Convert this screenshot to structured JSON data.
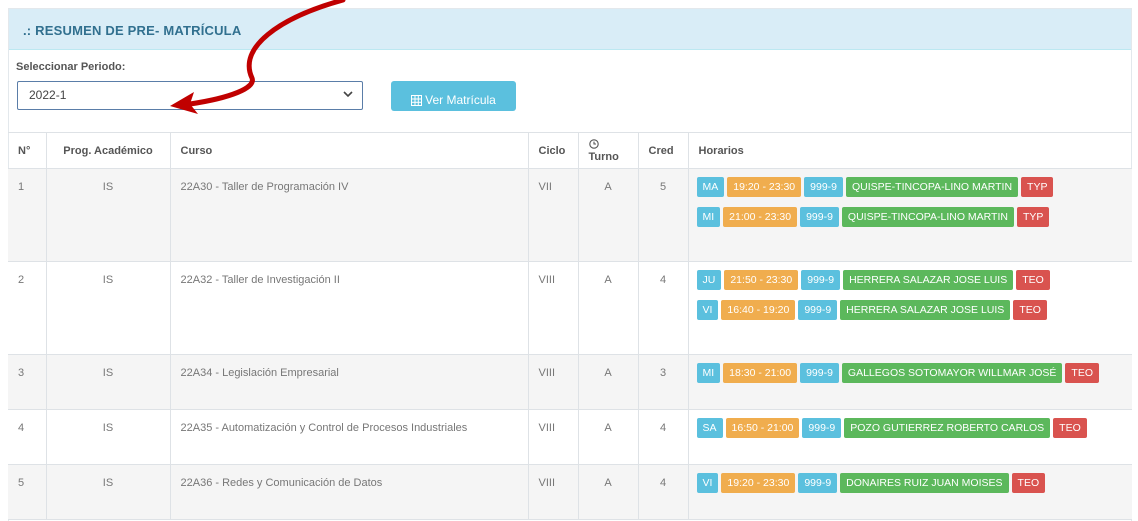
{
  "panel": {
    "title": ".: RESUMEN DE PRE- MATRÍCULA"
  },
  "filter": {
    "label": "Seleccionar Periodo:",
    "selected": "2022-1",
    "button_label": "Ver Matrícula"
  },
  "table": {
    "headers": {
      "num": "N°",
      "prog": "Prog. Académico",
      "curso": "Curso",
      "ciclo": "Ciclo",
      "turno": "Turno",
      "cred": "Cred",
      "horarios": "Horarios"
    },
    "rows": [
      {
        "num": "1",
        "prog": "IS",
        "curso": "22A30 - Taller de Programación IV",
        "ciclo": "VII",
        "turno": "A",
        "cred": "5",
        "horarios": [
          {
            "day": "MA",
            "time": "19:20 - 23:30",
            "room": "999-9",
            "teacher": "QUISPE-TINCOPA-LINO MARTIN",
            "type": "TYP"
          },
          {
            "day": "MI",
            "time": "21:00 - 23:30",
            "room": "999-9",
            "teacher": "QUISPE-TINCOPA-LINO MARTIN",
            "type": "TYP"
          }
        ]
      },
      {
        "num": "2",
        "prog": "IS",
        "curso": "22A32 - Taller de Investigación II",
        "ciclo": "VIII",
        "turno": "A",
        "cred": "4",
        "horarios": [
          {
            "day": "JU",
            "time": "21:50 - 23:30",
            "room": "999-9",
            "teacher": "HERRERA SALAZAR JOSE LUIS",
            "type": "TEO"
          },
          {
            "day": "VI",
            "time": "16:40 - 19:20",
            "room": "999-9",
            "teacher": "HERRERA SALAZAR JOSE LUIS",
            "type": "TEO"
          }
        ]
      },
      {
        "num": "3",
        "prog": "IS",
        "curso": "22A34 - Legislación Empresarial",
        "ciclo": "VIII",
        "turno": "A",
        "cred": "3",
        "horarios": [
          {
            "day": "MI",
            "time": "18:30 - 21:00",
            "room": "999-9",
            "teacher": "GALLEGOS SOTOMAYOR WILLMAR JOSÉ",
            "type": "TEO"
          }
        ]
      },
      {
        "num": "4",
        "prog": "IS",
        "curso": "22A35 - Automatización y Control de Procesos Industriales",
        "ciclo": "VIII",
        "turno": "A",
        "cred": "4",
        "horarios": [
          {
            "day": "SA",
            "time": "16:50 - 21:00",
            "room": "999-9",
            "teacher": "POZO GUTIERREZ ROBERTO CARLOS",
            "type": "TEO"
          }
        ]
      },
      {
        "num": "5",
        "prog": "IS",
        "curso": "22A36 - Redes y Comunicación de Datos",
        "ciclo": "VIII",
        "turno": "A",
        "cred": "4",
        "horarios": [
          {
            "day": "VI",
            "time": "19:20 - 23:30",
            "room": "999-9",
            "teacher": "DONAIRES RUIZ JUAN MOISES",
            "type": "TEO"
          }
        ]
      }
    ]
  },
  "colors": {
    "header_bg": "#d9edf7",
    "title": "#31708f",
    "info": "#5bc0de",
    "warning": "#f0ad4e",
    "success": "#5cb85c",
    "danger": "#d9534f",
    "arrow": "#c00000"
  }
}
